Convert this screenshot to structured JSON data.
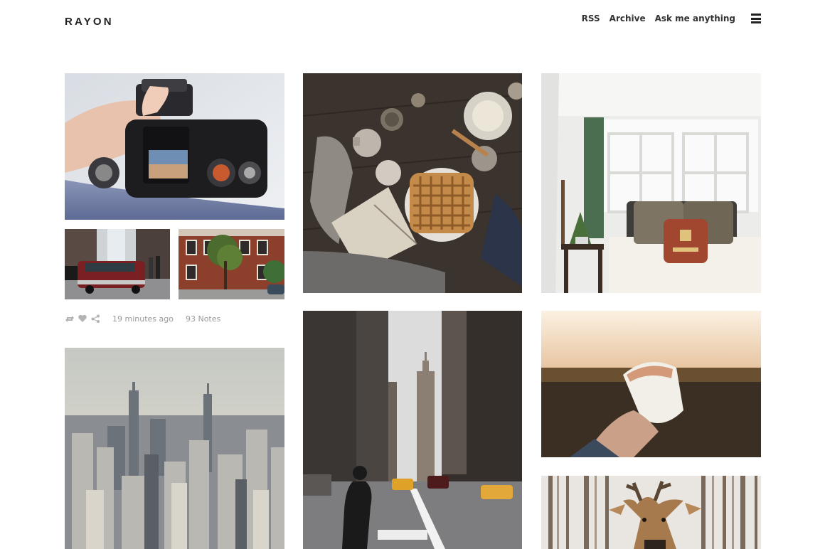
{
  "header": {
    "logo": "RAYON",
    "nav": [
      {
        "label": "RSS"
      },
      {
        "label": "Archive"
      },
      {
        "label": "Ask me anything"
      }
    ]
  },
  "post_meta": {
    "timestamp": "19 minutes ago",
    "notes": "93 Notes",
    "icons": [
      "reblog-icon",
      "heart-icon",
      "share-icon"
    ]
  },
  "photos": [
    {
      "name": "camera-photo"
    },
    {
      "name": "vintage-car-street-photo"
    },
    {
      "name": "brick-townhouse-photo"
    },
    {
      "name": "skyline-aerial-photo"
    },
    {
      "name": "breakfast-waffle-photo"
    },
    {
      "name": "city-street-crosswalk-photo"
    },
    {
      "name": "bedroom-window-photo"
    },
    {
      "name": "hand-holding-burrito-photo"
    },
    {
      "name": "deer-in-forest-photo"
    }
  ],
  "colors": {
    "text": "#222222",
    "meta": "#9a9a9a",
    "background": "#ffffff"
  }
}
